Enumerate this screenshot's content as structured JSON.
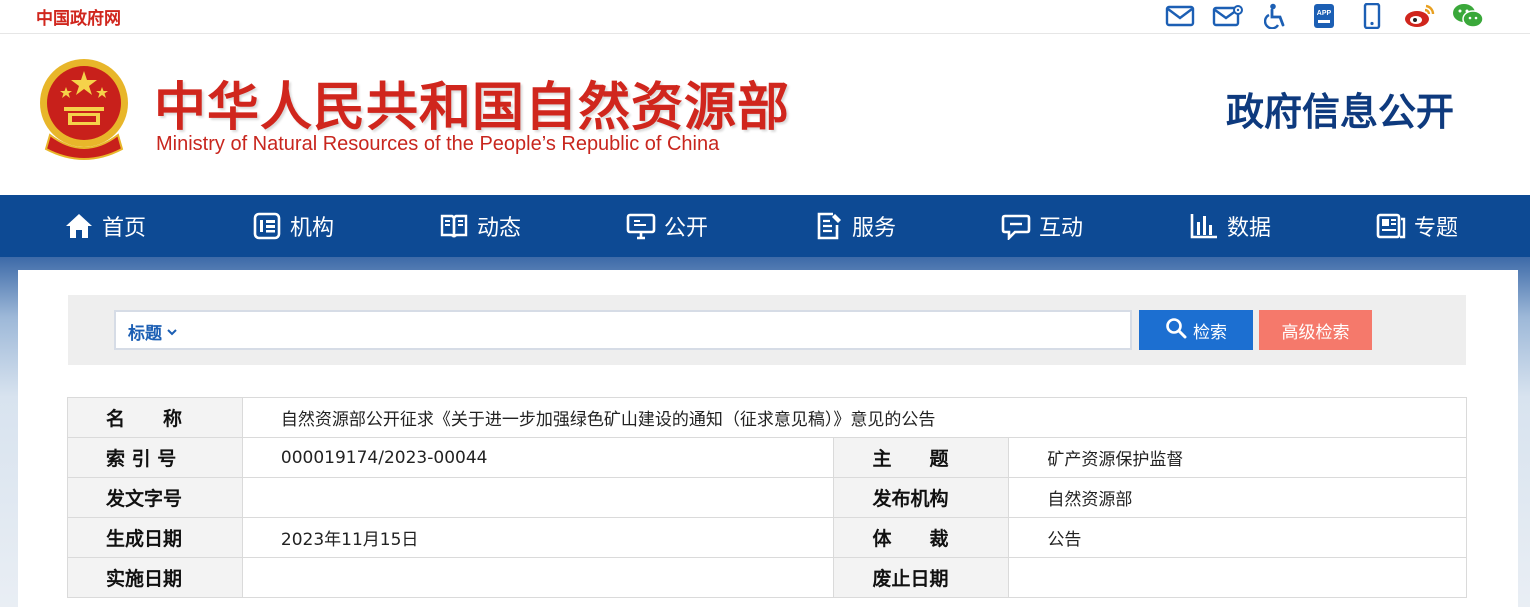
{
  "topbar": {
    "gov_link": "中国政府网",
    "icons": [
      "mail-icon",
      "mail-settings-icon",
      "accessibility-icon",
      "app-icon",
      "mobile-icon",
      "weibo-icon",
      "wechat-icon"
    ],
    "app_text": "APP"
  },
  "header": {
    "ministry_cn": "中华人民共和国自然资源部",
    "ministry_en": "Ministry of Natural Resources of the People’s Republic of China",
    "section_title": "政府信息公开"
  },
  "nav": {
    "items": [
      {
        "label": "首页",
        "icon": "home-icon"
      },
      {
        "label": "机构",
        "icon": "org-icon"
      },
      {
        "label": "动态",
        "icon": "book-icon"
      },
      {
        "label": "公开",
        "icon": "monitor-icon"
      },
      {
        "label": "服务",
        "icon": "form-icon"
      },
      {
        "label": "互动",
        "icon": "chat-icon"
      },
      {
        "label": "数据",
        "icon": "bar-chart-icon"
      },
      {
        "label": "专题",
        "icon": "topic-icon"
      }
    ]
  },
  "search": {
    "type_label": "标题",
    "value": "",
    "search_label": "检索",
    "advanced_label": "高级检索"
  },
  "info": {
    "name_label": "名　　称",
    "name_value": "自然资源部公开征求《关于进一步加强绿色矿山建设的通知（征求意见稿）》意见的公告",
    "index_label": "索 引 号",
    "index_value": "000019174/2023-00044",
    "topic_label": "主　　题",
    "topic_value": "矿产资源保护监督",
    "docno_label": "发文字号",
    "docno_value": "",
    "publisher_label": "发布机构",
    "publisher_value": "自然资源部",
    "date_label": "生成日期",
    "date_value": "2023年11月15日",
    "genre_label": "体　　裁",
    "genre_value": "公告",
    "effective_label": "实施日期",
    "effective_value": "",
    "expiry_label": "废止日期",
    "expiry_value": ""
  },
  "colors": {
    "brand_red": "#d0261d",
    "nav_blue": "#0d4a94",
    "title_blue": "#0e3a7e",
    "search_blue": "#1c6fd1",
    "advanced_coral": "#f5796b"
  }
}
